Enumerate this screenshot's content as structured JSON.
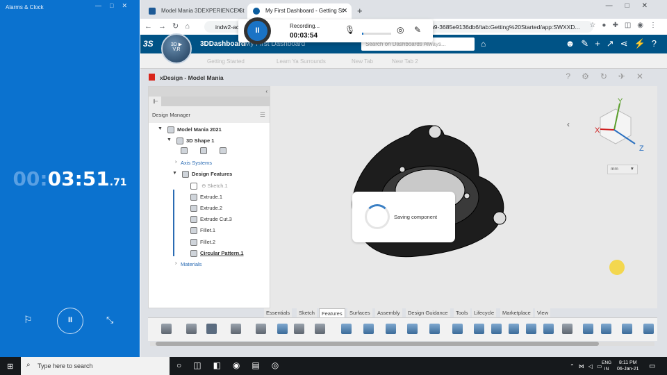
{
  "alarms": {
    "window_title": "Alarms & Clock",
    "timer": {
      "dim": "00:",
      "main": "03:51",
      "fraction": ".71"
    }
  },
  "browser": {
    "tabs": [
      {
        "label": "Model Mania 3DEXPERIENCE St"
      },
      {
        "label": "My First Dashboard - Getting St"
      }
    ],
    "url_start": "indw2-aca",
    "url_end": "a9-3685e9136db6/tab:Getting%20Started/app:SWXXD..."
  },
  "dashboard": {
    "brand": "3DDashboard",
    "subtitle": "My First Dashboard",
    "search_placeholder": "Search on Dashboards Always...",
    "compass": {
      "top": "3D",
      "bottom": "V,R"
    },
    "tabs": [
      "Getting Started",
      "Learn Ya Surrounds",
      "New Tab",
      "New Tab 2"
    ]
  },
  "app": {
    "title": "xDesign - Model Mania",
    "design_manager": "Design Manager",
    "tree": {
      "root": "Model Mania 2021",
      "shape": "3D Shape 1",
      "axis_systems": "Axis Systems",
      "design_features": "Design Features",
      "features": [
        "Sketch.1",
        "Extrude.1",
        "Extrude.2",
        "Extrude Cut.3",
        "Fillet.1",
        "Fillet.2",
        "Circular Pattern.1"
      ],
      "materials": "Materials"
    },
    "unit": "mm",
    "loading_text": "Saving component",
    "command_tabs": [
      "Essentials",
      "Sketch",
      "Features",
      "Surfaces",
      "Assembly",
      "Design Guidance",
      "Tools",
      "Lifecycle",
      "Marketplace",
      "View"
    ],
    "active_tab": "Features"
  },
  "recording": {
    "status": "Recording...",
    "time": "00:03:54"
  },
  "taskbar": {
    "search_placeholder": "Type here to search",
    "lang": "ENG",
    "region": "IN",
    "time": "8:11 PM",
    "date": "06-Jan-21"
  },
  "colors": {
    "alarm_bg": "#0b72cf",
    "dashboard_bar": "#005386",
    "accent": "#1a73c5"
  }
}
